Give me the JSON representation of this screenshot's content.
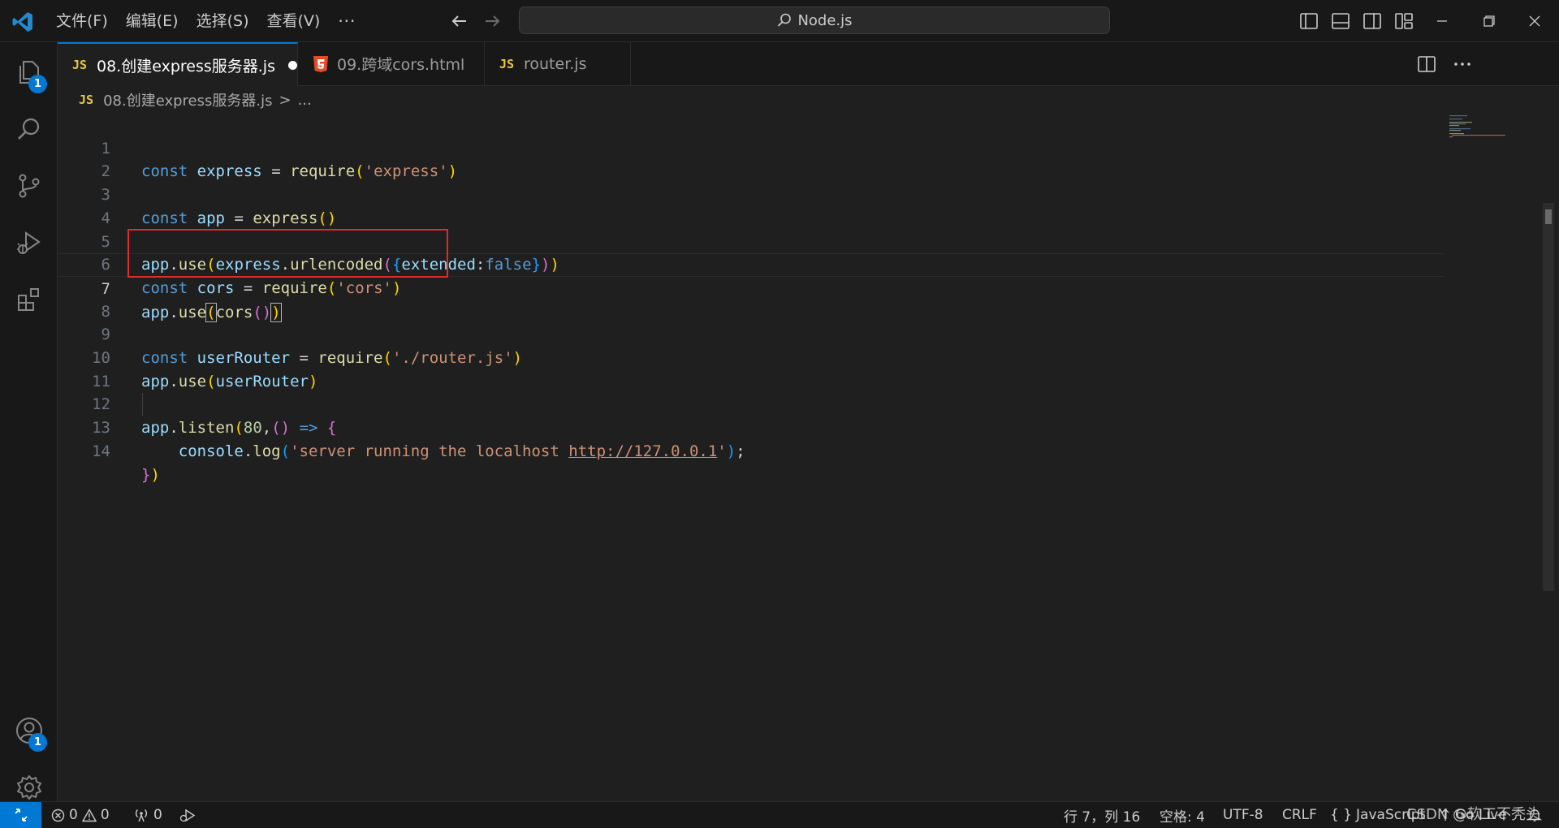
{
  "title_bar": {
    "menu": [
      "文件(F)",
      "编辑(E)",
      "选择(S)",
      "查看(V)"
    ],
    "more_menu_label": "···",
    "command_center_text": "Node.js"
  },
  "activity_bar": {
    "explorer_badge": "1",
    "accounts_badge": "1"
  },
  "tabs": [
    {
      "label": "08.创建express服务器.js",
      "icon": "JS"
    },
    {
      "label": "09.跨域cors.html",
      "icon": "html5-icon"
    },
    {
      "label": "router.js",
      "icon": "JS"
    }
  ],
  "breadcrumb": {
    "icon": "JS",
    "file": "08.创建express服务器.js",
    "separator": ">",
    "rest": "..."
  },
  "editor": {
    "line_numbers": [
      "1",
      "2",
      "3",
      "4",
      "5",
      "6",
      "7",
      "8",
      "9",
      "10",
      "11",
      "12",
      "13",
      "14"
    ],
    "current_line": 7,
    "code_lines": [
      "const express = require('express')",
      "",
      "const app = express()",
      "",
      "app.use(express.urlencoded({extended:false}))",
      "const cors = require('cors')",
      "app.use(cors())",
      "",
      "const userRouter = require('./router.js')",
      "app.use(userRouter)",
      "",
      "app.listen(80,() => {",
      "    console.log('server running the localhost http://127.0.0.1');",
      "})"
    ]
  },
  "status_bar": {
    "errors": "0",
    "warnings": "0",
    "ports": "0",
    "cursor_position": "行 7，列 16",
    "indentation": "空格: 4",
    "encoding": "UTF-8",
    "eol": "CRLF",
    "language_brackets": "{ }",
    "language": "JavaScript",
    "go_live": "Go Live"
  },
  "watermark": "CSDN @软工不秃头",
  "colors": {
    "accent": "#0078d4",
    "highlight_box": "#e02b2b",
    "keyword": "#569cd6",
    "string": "#ce9178",
    "function": "#dcdcaa",
    "variable": "#9cdcfe"
  }
}
